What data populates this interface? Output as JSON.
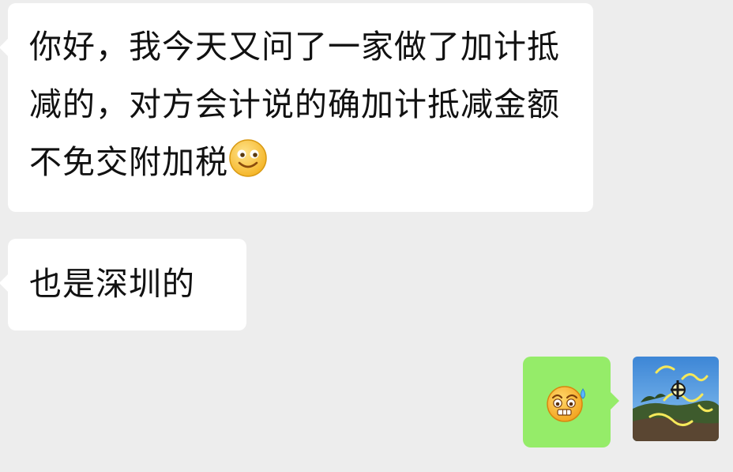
{
  "chat": {
    "messages": [
      {
        "side": "left",
        "text": "你好，我今天又问了一家做了加计抵减的，对方会计说的确加计抵减金额不免交附加税",
        "trailing_emoji": "smile-emoji"
      },
      {
        "side": "left",
        "text": "也是深圳的"
      },
      {
        "side": "right",
        "emoji": "sweat-emoji"
      }
    ],
    "self_avatar": "user-avatar"
  },
  "colors": {
    "background": "#ededed",
    "incoming_bubble": "#ffffff",
    "outgoing_bubble": "#95ec69",
    "text": "#111111"
  }
}
